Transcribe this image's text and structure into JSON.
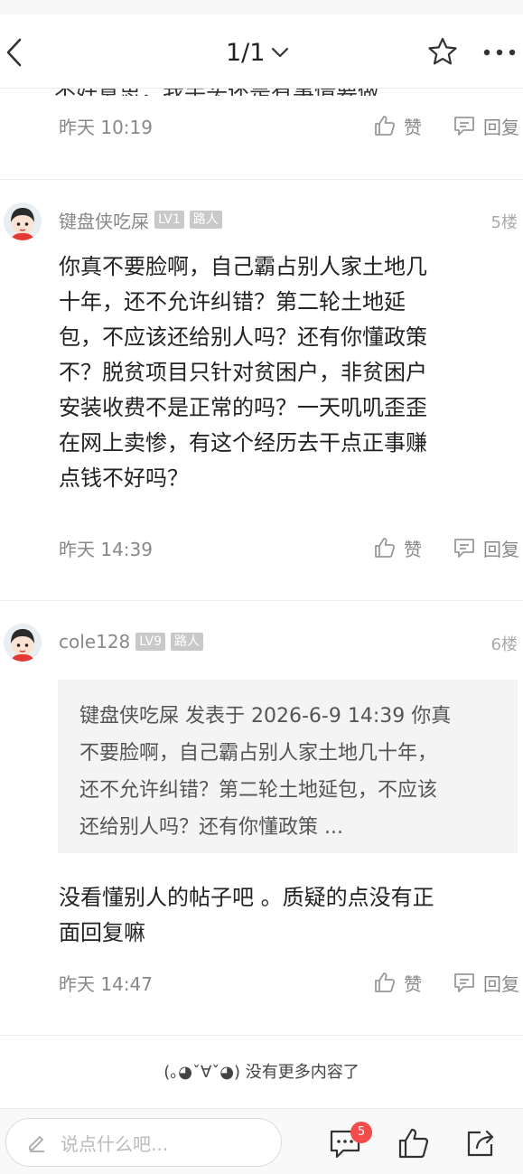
{
  "header": {
    "page_indicator": "1/1"
  },
  "cutoff_text": "不好意思，我手头还是有事情要做",
  "comments": [
    {
      "time": "昨天 10:19",
      "like_label": "赞",
      "reply_label": "回复"
    },
    {
      "username": "键盘侠吃屎",
      "level": "LV1",
      "role": "路人",
      "floor": "5楼",
      "lines": [
        "你真不要脸啊，自己霸占别人家土地几",
        "十年，还不允许纠错？第二轮土地延",
        "包，不应该还给别人吗？还有你懂政策",
        "不？脱贫项目只针对贫困户，非贫困户",
        "安装收费不是正常的吗？一天叽叽歪歪",
        "在网上卖惨，有这个经历去干点正事赚",
        "点钱不好吗？"
      ],
      "time": "昨天 14:39",
      "like_label": "赞",
      "reply_label": "回复"
    },
    {
      "username": "cole128",
      "level": "LV9",
      "role": "路人",
      "floor": "6楼",
      "quote_lines": [
        "键盘侠吃屎 发表于 2026-6-9 14:39 你真",
        "不要脸啊，自己霸占别人家土地几十年，",
        "还不允许纠错？第二轮土地延包，不应该",
        "还给别人吗？还有你懂政策 ..."
      ],
      "lines": [
        "没看懂别人的帖子吧 。质疑的点没有正",
        "面回复嘛"
      ],
      "time": "昨天 14:47",
      "like_label": "赞",
      "reply_label": "回复"
    }
  ],
  "end_note": "(｡◕ˇ∀ˇ◕) 没有更多内容了",
  "bottom_bar": {
    "input_placeholder": "说点什么吧...",
    "comment_count": "5"
  },
  "colors": {
    "badge_red": "#f44b4b",
    "muted_text": "#888888",
    "quote_bg": "#f4f4f4"
  }
}
